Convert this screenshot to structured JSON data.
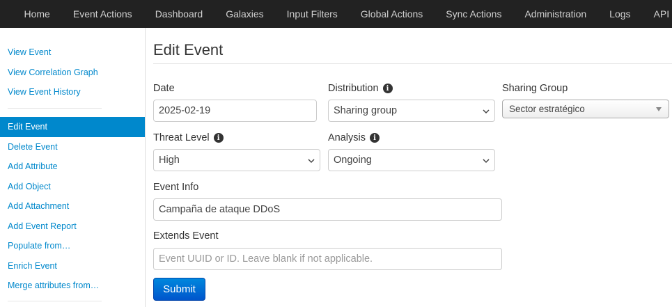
{
  "navbar": {
    "items": [
      "Home",
      "Event Actions",
      "Dashboard",
      "Galaxies",
      "Input Filters",
      "Global Actions",
      "Sync Actions",
      "Administration",
      "Logs",
      "API"
    ]
  },
  "sidebar": {
    "view_items": [
      "View Event",
      "View Correlation Graph",
      "View Event History"
    ],
    "edit_items": [
      "Edit Event",
      "Delete Event",
      "Add Attribute",
      "Add Object",
      "Add Attachment",
      "Add Event Report",
      "Populate from…",
      "Enrich Event",
      "Merge attributes from…"
    ],
    "active": "Edit Event"
  },
  "main": {
    "title": "Edit Event",
    "date": {
      "label": "Date",
      "value": "2025-02-19"
    },
    "distribution": {
      "label": "Distribution",
      "value": "Sharing group",
      "info_icon": "info-circle-icon"
    },
    "sharing_group": {
      "label": "Sharing Group",
      "value": "Sector estratégico"
    },
    "threat_level": {
      "label": "Threat Level",
      "value": "High",
      "info_icon": "info-circle-icon"
    },
    "analysis": {
      "label": "Analysis",
      "value": "Ongoing",
      "info_icon": "info-circle-icon"
    },
    "event_info": {
      "label": "Event Info",
      "value": "Campaña de ataque DDoS"
    },
    "extends_event": {
      "label": "Extends Event",
      "placeholder": "Event UUID or ID. Leave blank if not applicable.",
      "value": ""
    },
    "submit_label": "Submit"
  },
  "colors": {
    "navbar_bg": "#222222",
    "link": "#0088cc",
    "active_bg": "#0088cc",
    "submit_bg": "#0066cc"
  }
}
